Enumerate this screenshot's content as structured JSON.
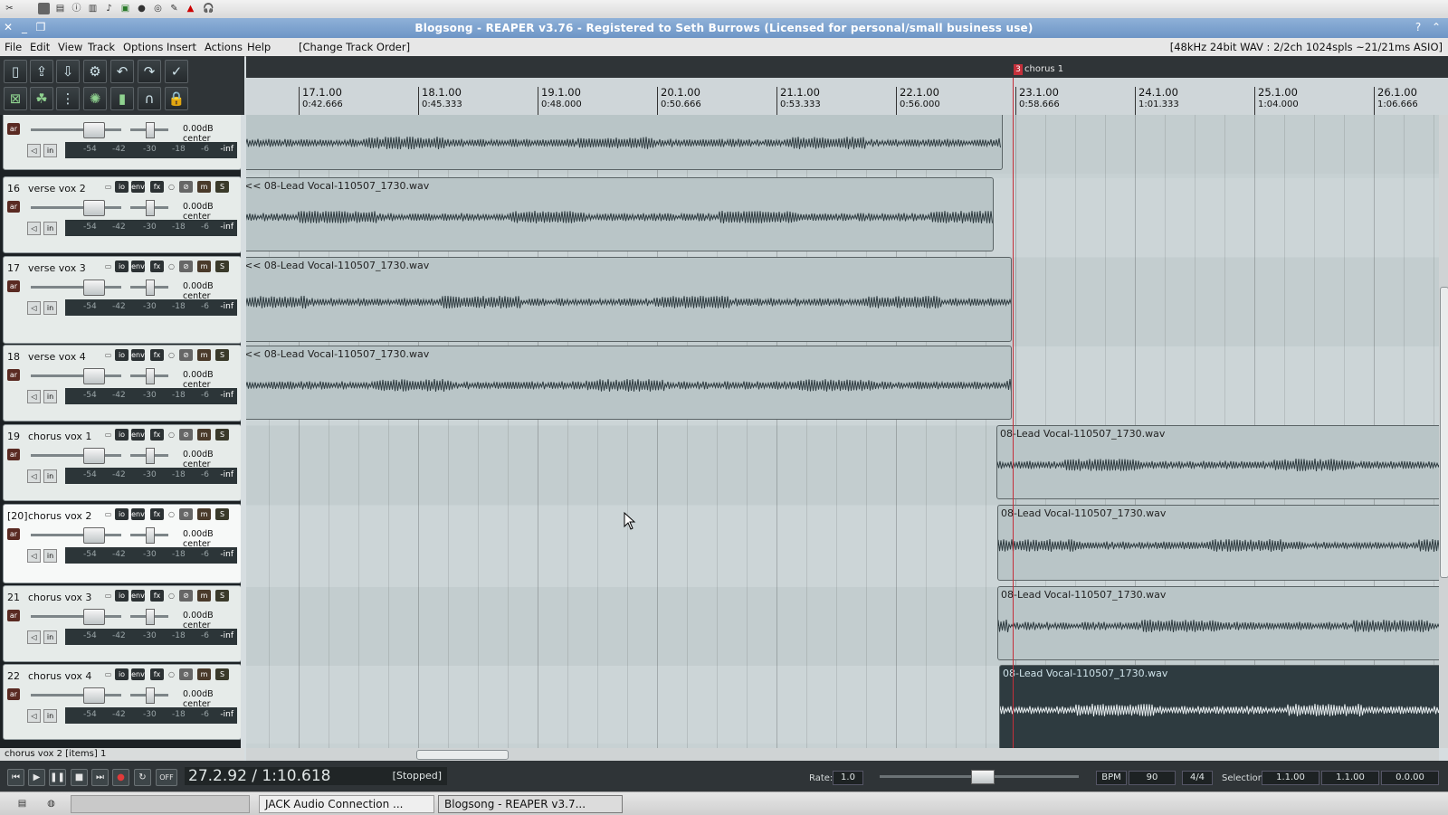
{
  "system_bar": {
    "icons": [
      "tool-icon",
      "window-icon",
      "terminal-icon",
      "info-icon",
      "chart-icon",
      "volume-icon",
      "image-icon",
      "disk-icon",
      "cd-icon",
      "pen-icon",
      "warning-icon",
      "headphones-icon"
    ]
  },
  "window": {
    "title": "Blogsong - REAPER v3.76 - Registered to Seth Burrows (Licensed for personal/small business use)"
  },
  "menu": {
    "items": [
      "File",
      "Edit",
      "View",
      "Track",
      "Options",
      "Insert",
      "Actions",
      "Help"
    ],
    "extra": "[Change Track Order]",
    "status": "[48kHz 24bit WAV : 2/2ch 1024spls ~21/21ms ASIO]"
  },
  "toolbar": {
    "row1": [
      "new-project",
      "open-project",
      "save-project",
      "settings",
      "undo",
      "redo",
      "metronome"
    ],
    "row2": [
      "snap",
      "ripple",
      "grid",
      "envelope",
      "lock-meters",
      "headphones",
      "lock"
    ]
  },
  "marker": {
    "number": "3",
    "label": "chorus 1"
  },
  "ruler": {
    "marks": [
      {
        "bar": "17.1.00",
        "time": "0:42.666"
      },
      {
        "bar": "18.1.00",
        "time": "0:45.333"
      },
      {
        "bar": "19.1.00",
        "time": "0:48.000"
      },
      {
        "bar": "20.1.00",
        "time": "0:50.666"
      },
      {
        "bar": "21.1.00",
        "time": "0:53.333"
      },
      {
        "bar": "22.1.00",
        "time": "0:56.000"
      },
      {
        "bar": "23.1.00",
        "time": "0:58.666"
      },
      {
        "bar": "24.1.00",
        "time": "1:01.333"
      },
      {
        "bar": "25.1.00",
        "time": "1:04.000"
      },
      {
        "bar": "26.1.00",
        "time": "1:06.666"
      }
    ]
  },
  "track_controls": {
    "io": "io",
    "env": "env",
    "fx": "fx",
    "mute": "m",
    "solo": "S",
    "arm": "ar",
    "volume": "0.00dB",
    "pan": "center",
    "meter": [
      "-54",
      "-42",
      "-30",
      "-18",
      "-6",
      "-inf"
    ]
  },
  "tracks": [
    {
      "num": "",
      "name": ""
    },
    {
      "num": "16",
      "name": "verse vox 2"
    },
    {
      "num": "17",
      "name": "verse vox 3"
    },
    {
      "num": "18",
      "name": "verse vox 4"
    },
    {
      "num": "19",
      "name": "chorus vox 1"
    },
    {
      "num": "[20]",
      "name": "chorus vox 2"
    },
    {
      "num": "21",
      "name": "chorus vox 3"
    },
    {
      "num": "22",
      "name": "chorus vox 4"
    }
  ],
  "items": {
    "verse_prefix": "<< 08-Lead Vocal-110507_1730.wav",
    "chorus": "08-Lead Vocal-110507_1730.wav"
  },
  "status": "chorus vox 2 [items] 1",
  "transport": {
    "position": "27.2.92 / 1:10.618",
    "state": "[Stopped]",
    "off": "OFF",
    "rate_label": "Rate:",
    "rate": "1.0",
    "bpm_label": "BPM",
    "bpm": "90",
    "timesig": "4/4",
    "selection_label": "Selection:",
    "sel_start": "1.1.00",
    "sel_end": "1.1.00",
    "sel_len": "0.0.00"
  },
  "taskbar": {
    "tasks": [
      "JACK Audio Connection ...",
      "Blogsong - REAPER v3.7..."
    ]
  }
}
